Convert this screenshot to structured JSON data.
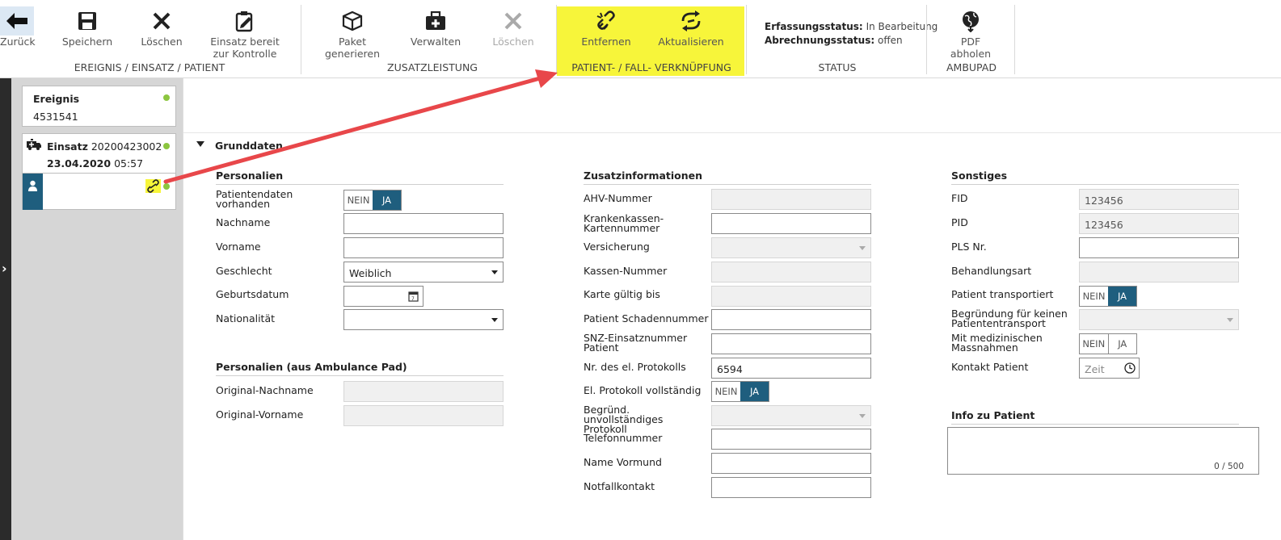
{
  "ribbon": {
    "back": "Zurück",
    "save": "Speichern",
    "delete": "Löschen",
    "ready_line1": "Einsatz bereit",
    "ready_line2": "zur Kontrolle",
    "group1": "EREIGNIS / EINSATZ / PATIENT",
    "package_line1": "Paket",
    "package_line2": "generieren",
    "manage": "Verwalten",
    "delete2": "Löschen",
    "group2": "ZUSATZLEISTUNG",
    "remove": "Entfernen",
    "refresh": "Aktualisieren",
    "group3": "PATIENT- / FALL- VERKNÜPFUNG",
    "status_capture_label": "Erfassungsstatus:",
    "status_capture_value": "In Bearbeitung",
    "status_billing_label": "Abrechnungsstatus:",
    "status_billing_value": "offen",
    "group4": "STATUS",
    "pdf_line1": "PDF",
    "pdf_line2": "abholen",
    "group5": "AMBUPAD",
    "highlight_color": "#f7f53a"
  },
  "sidebar": {
    "event_title": "Ereignis",
    "event_number": "4531541",
    "mission_title": "Einsatz",
    "mission_number": "20200423002",
    "mission_date": "23.04.2020",
    "mission_time": "05:57"
  },
  "section_title": "Grunddaten",
  "personalien": {
    "title": "Personalien",
    "patient_data_label": "Patientendaten vorhanden",
    "nachname": "Nachname",
    "vorname": "Vorname",
    "geschlecht": "Geschlecht",
    "geschlecht_value": "Weiblich",
    "geburtsdatum": "Geburtsdatum",
    "nationalitaet": "Nationalität",
    "no": "NEIN",
    "yes": "JA"
  },
  "ambulance": {
    "title": "Personalien (aus Ambulance Pad)",
    "orig_nachname": "Original-Nachname",
    "orig_vorname": "Original-Vorname"
  },
  "zusatz": {
    "title": "Zusatzinformationen",
    "ahv": "AHV-Nummer",
    "kk_karte": "Krankenkassen-Kartennummer",
    "versicherung": "Versicherung",
    "kassen_nr": "Kassen-Nummer",
    "karte_gueltig": "Karte gültig bis",
    "schadennummer": "Patient Schadennummer",
    "snz": "SNZ-Einsatznummer Patient",
    "protokoll_nr": "Nr. des el. Protokolls",
    "protokoll_nr_value": "6594",
    "protokoll_vollst": "El. Protokoll vollständig",
    "begruend_unvollst": "Begründ. unvollständiges Protokoll",
    "telefon": "Telefonnummer",
    "vormund": "Name Vormund",
    "notfall": "Notfallkontakt"
  },
  "sonstiges": {
    "title": "Sonstiges",
    "fid": "FID",
    "fid_value": "123456",
    "pid": "PID",
    "pid_value": "123456",
    "pls": "PLS Nr.",
    "behandlungsart": "Behandlungsart",
    "transportiert": "Patient transportiert",
    "begruend_kein": "Begründung für keinen Patiententransport",
    "massnahmen": "Mit medizinischen Massnahmen",
    "kontakt": "Kontakt Patient",
    "kontakt_placeholder": "Zeit"
  },
  "info": {
    "title": "Info zu Patient",
    "counter": "0 / 500"
  }
}
